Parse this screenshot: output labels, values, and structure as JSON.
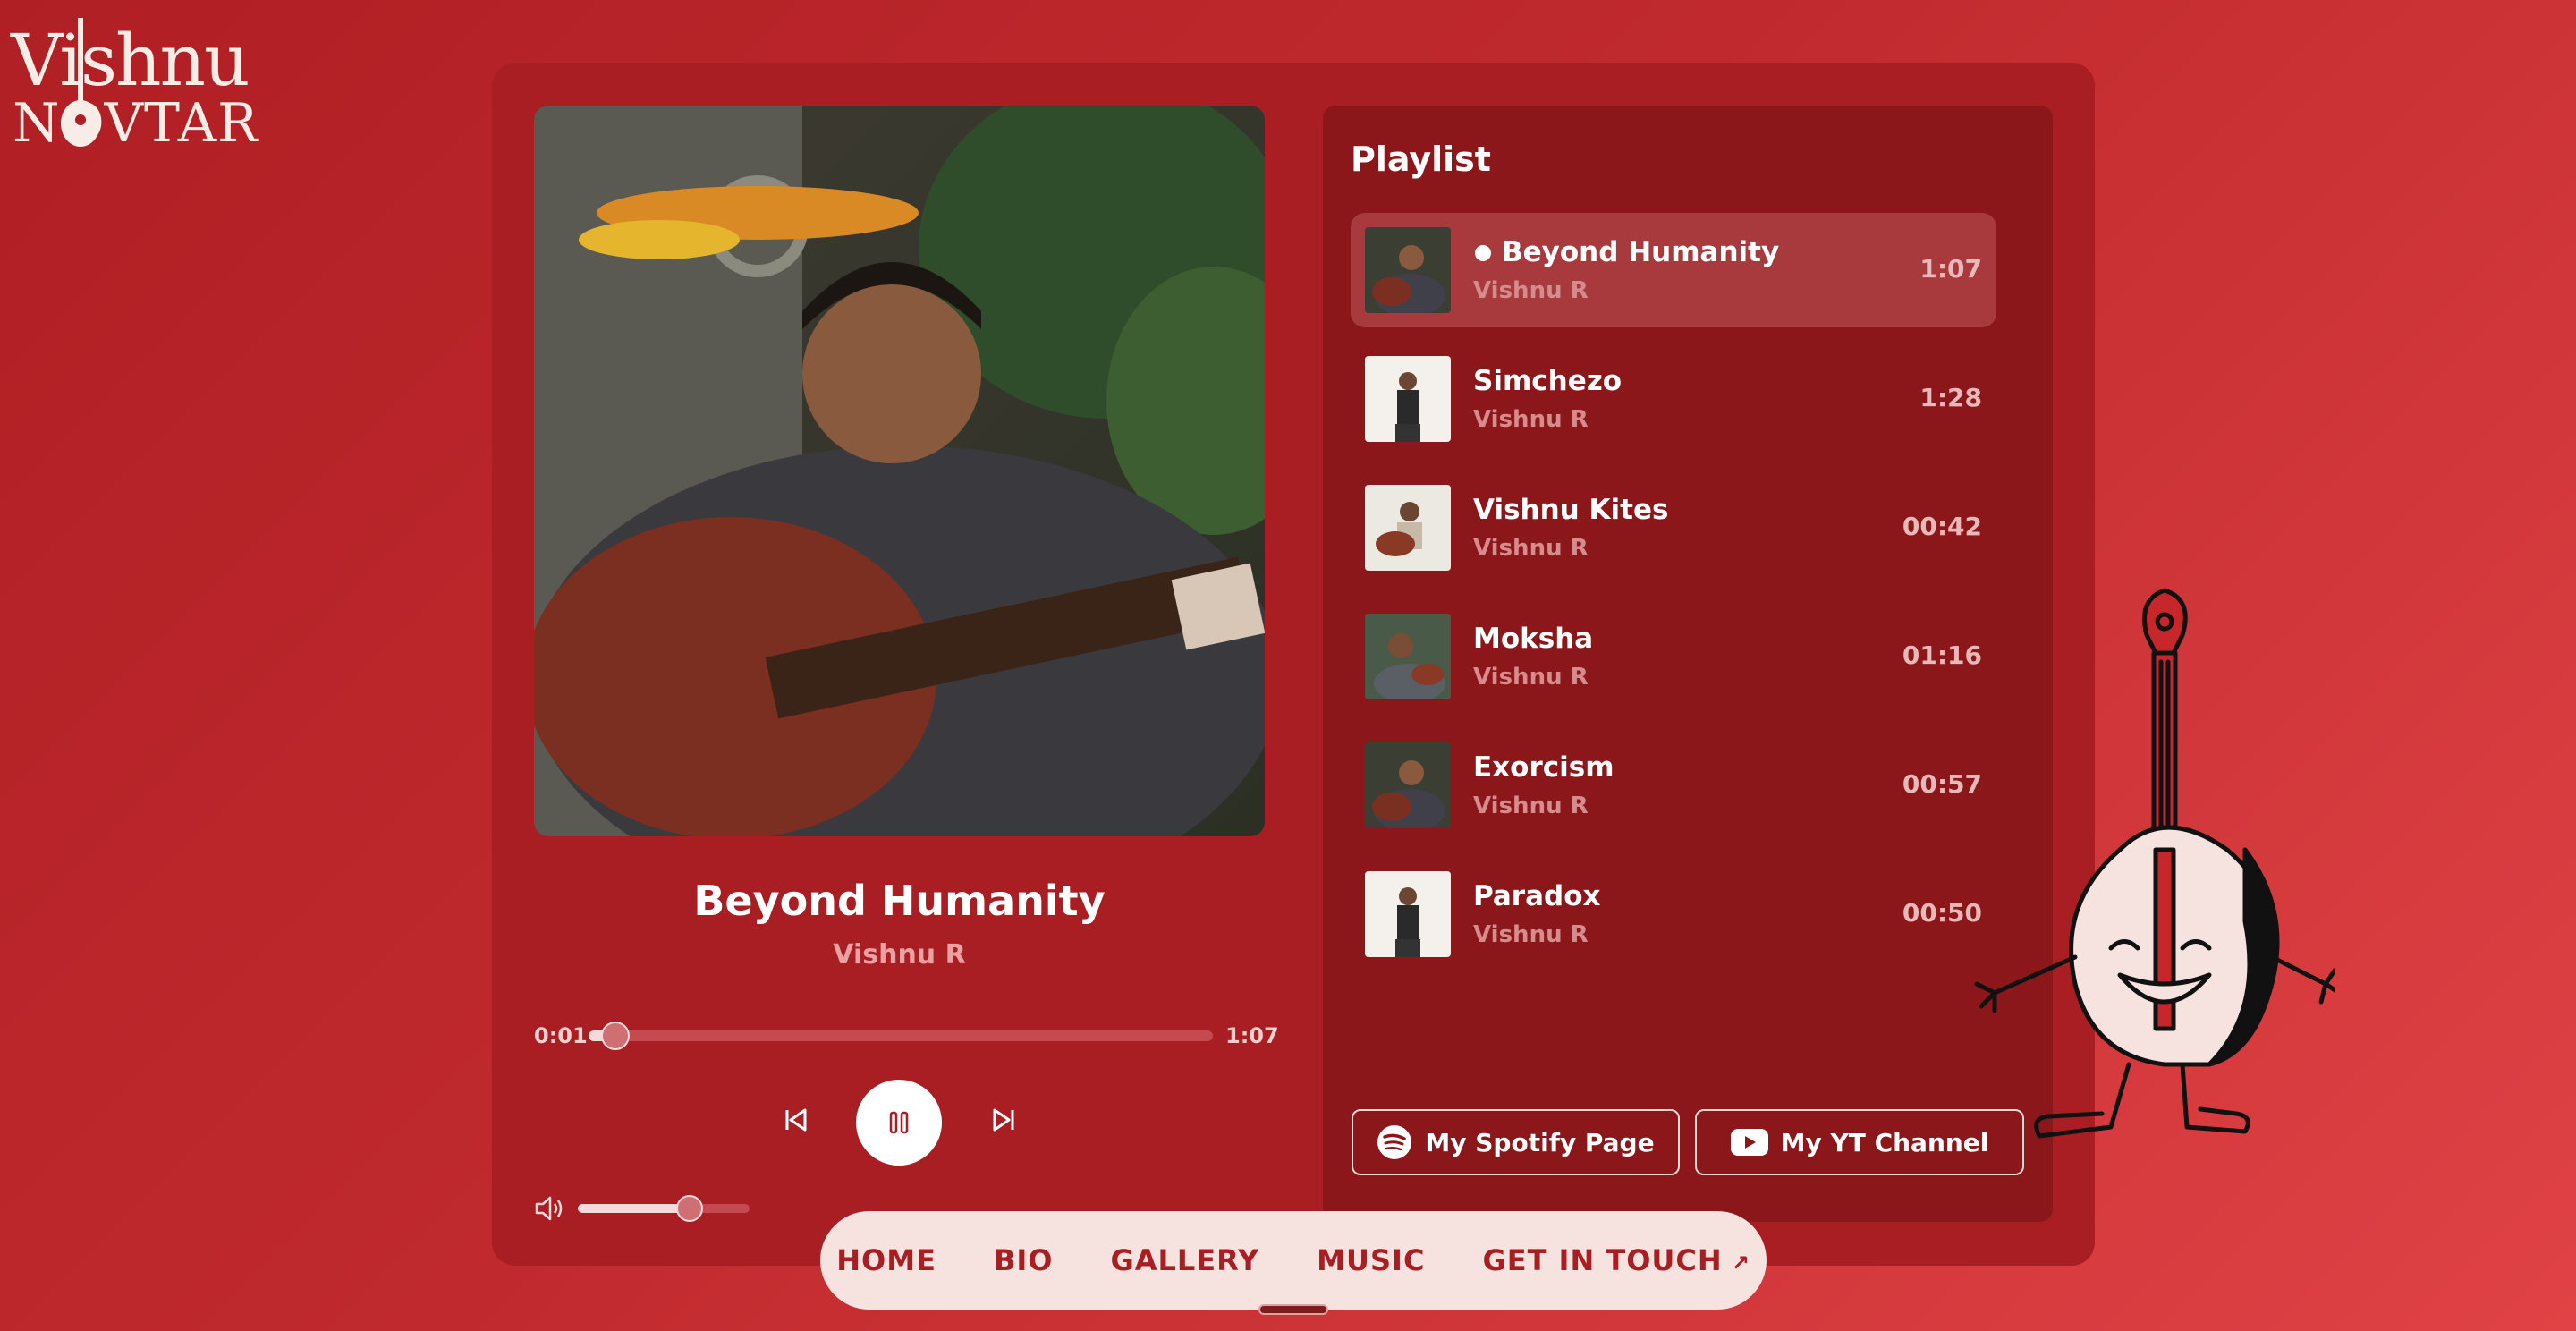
{
  "logo": {
    "line1": "Vishnu",
    "line2": "NOVTAR"
  },
  "player": {
    "title": "Beyond Humanity",
    "artist": "Vishnu R",
    "current_time": "0:01",
    "total_time": "1:07",
    "progress_fraction": 0.02,
    "volume_fraction": 0.65,
    "icons": {
      "prev": "skip-previous-icon",
      "play": "pause-icon",
      "next": "skip-next-icon",
      "volume": "volume-icon"
    }
  },
  "playlist": {
    "heading": "Playlist",
    "items": [
      {
        "title": "Beyond Humanity",
        "artist": "Vishnu R",
        "duration": "1:07",
        "active": true
      },
      {
        "title": "Simchezo",
        "artist": "Vishnu R",
        "duration": "1:28",
        "active": false
      },
      {
        "title": "Vishnu Kites",
        "artist": "Vishnu R",
        "duration": "00:42",
        "active": false
      },
      {
        "title": "Moksha",
        "artist": "Vishnu R",
        "duration": "01:16",
        "active": false
      },
      {
        "title": "Exorcism",
        "artist": "Vishnu R",
        "duration": "00:57",
        "active": false
      },
      {
        "title": "Paradox",
        "artist": "Vishnu R",
        "duration": "00:50",
        "active": false
      }
    ]
  },
  "links": {
    "spotify": "My Spotify Page",
    "youtube": "My YT Channel"
  },
  "nav": {
    "home": "HOME",
    "bio": "BIO",
    "gallery": "GALLERY",
    "music": "MUSIC",
    "contact": "GET IN TOUCH",
    "contact_arrow": "↗"
  },
  "colors": {
    "background": "#c02a2e",
    "card": "#a81e23",
    "panel": "#8c171b",
    "nav": "#f6e3df",
    "accent_text": "#a81e23"
  }
}
